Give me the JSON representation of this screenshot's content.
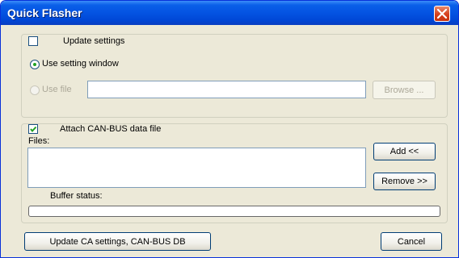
{
  "window": {
    "title": "Quick Flasher"
  },
  "settings": {
    "update_label": "Update settings",
    "update_checked": false,
    "use_window_label": "Use setting window",
    "use_window_selected": true,
    "use_file_label": "Use file",
    "use_file_enabled": false,
    "file_path_value": "",
    "browse_label": "Browse ..."
  },
  "canbus": {
    "attach_label": "Attach CAN-BUS data file",
    "attach_checked": true,
    "files_label": "Files:",
    "files": [],
    "add_label": "Add <<",
    "remove_label": "Remove >>",
    "buffer_label": "Buffer status:",
    "buffer_fraction": 0
  },
  "footer": {
    "update_button_label": "Update CA settings, CAN-BUS DB",
    "cancel_label": "Cancel"
  }
}
